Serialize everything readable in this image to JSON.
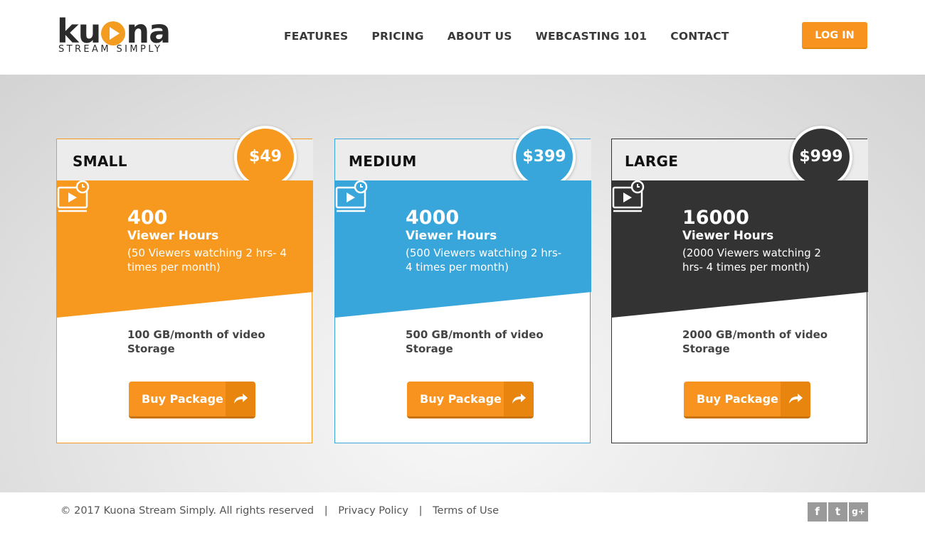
{
  "logo": {
    "word": "kuona",
    "tagline": "STREAM SIMPLY"
  },
  "nav": [
    {
      "label": "FEATURES"
    },
    {
      "label": "PRICING"
    },
    {
      "label": "ABOUT US"
    },
    {
      "label": "WEBCASTING 101"
    },
    {
      "label": "CONTACT"
    }
  ],
  "login_label": "LOG IN",
  "plans": [
    {
      "name": "SMALL",
      "price": "$49",
      "hours": "400",
      "unit": "Viewer Hours",
      "desc": "(50 Viewers watching 2 hrs- 4 times per month)",
      "storage": "100 GB/month of video Storage",
      "button": "Buy Package",
      "color": "#f7991f"
    },
    {
      "name": "MEDIUM",
      "price": "$399",
      "hours": "4000",
      "unit": "Viewer Hours",
      "desc": "(500 Viewers watching 2 hrs- 4 times per month)",
      "storage": "500 GB/month of video Storage",
      "button": "Buy Package",
      "color": "#38a6da"
    },
    {
      "name": "LARGE",
      "price": "$999",
      "hours": "16000",
      "unit": "Viewer Hours",
      "desc": "(2000 Viewers watching 2 hrs- 4 times per month)",
      "storage": "2000 GB/month of video Storage",
      "button": "Buy Package",
      "color": "#333333"
    }
  ],
  "footer": {
    "copyright": "© 2017 Kuona Stream Simply. All rights reserved",
    "sep": "|",
    "privacy": "Privacy Policy",
    "terms": "Terms of Use"
  },
  "social": [
    {
      "icon": "facebook-icon",
      "glyph": "f"
    },
    {
      "icon": "twitter-icon",
      "glyph": "t"
    },
    {
      "icon": "google-plus-icon",
      "glyph": "g+"
    }
  ],
  "colors": {
    "accent": "#f7931e"
  }
}
